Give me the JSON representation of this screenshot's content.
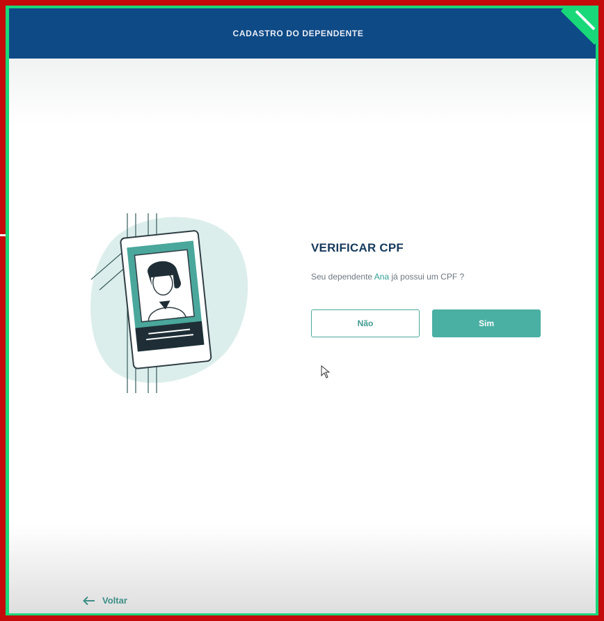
{
  "header": {
    "title": "CADASTRO DO DEPENDENTE"
  },
  "verify": {
    "title": "VERIFICAR CPF",
    "question_prefix": "Seu dependente",
    "dependent_name": "Ana",
    "question_suffix": "já possui um CPF ?"
  },
  "buttons": {
    "no_label": "Não",
    "yes_label": "Sim"
  },
  "footer": {
    "back_label": "Voltar"
  },
  "icons": {
    "back": "arrow-left-icon",
    "corner": "expand-icon",
    "cursor": "mouse-cursor-icon"
  },
  "colors": {
    "header_bg": "#0e4a86",
    "accent": "#4ab0a3",
    "frame_border": "#19d87a",
    "outer_border": "#c40a0a"
  }
}
